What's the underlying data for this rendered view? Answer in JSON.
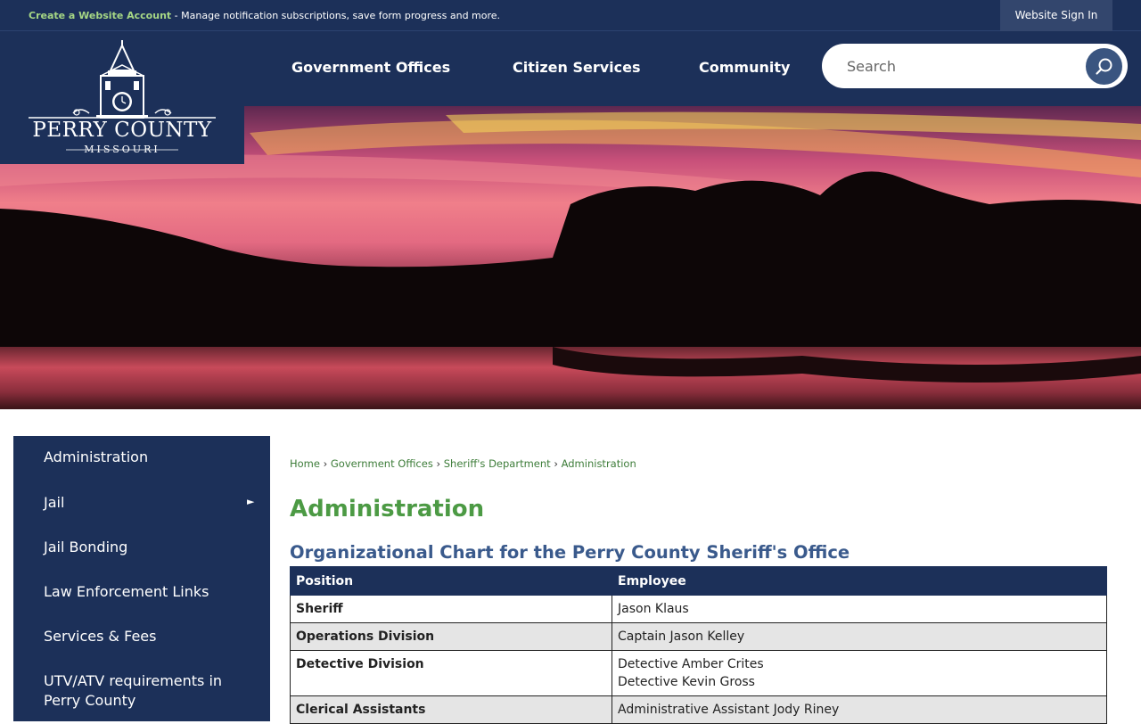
{
  "topbar": {
    "create_account": "Create a Website Account",
    "account_text": " - Manage notification subscriptions, save form progress and more.",
    "sign_in": "Website Sign In"
  },
  "logo": {
    "name": "PERRY COUNTY",
    "sub": "MISSOURI"
  },
  "nav": [
    "Government Offices",
    "Citizen Services",
    "Community"
  ],
  "search": {
    "placeholder": "Search"
  },
  "sidebar": {
    "items": [
      "Administration",
      "Jail",
      "Jail Bonding",
      "Law Enforcement Links",
      "Services & Fees",
      "UTV/ATV requirements in Perry County"
    ]
  },
  "breadcrumb": [
    "Home",
    "Government Offices",
    "Sheriff's Department",
    "Administration"
  ],
  "page": {
    "title": "Administration",
    "chart_title": "Organizational Chart for the Perry County Sheriff's Office"
  },
  "table": {
    "headers": [
      "Position",
      "Employee"
    ],
    "rows": [
      {
        "position": "Sheriff",
        "employees": [
          "Jason Klaus"
        ]
      },
      {
        "position": "Operations Division",
        "employees": [
          "Captain Jason Kelley"
        ]
      },
      {
        "position": "Detective Division",
        "employees": [
          "Detective Amber Crites",
          "Detective Kevin Gross"
        ]
      },
      {
        "position": "Clerical Assistants",
        "employees": [
          "Administrative Assistant Jody Riney"
        ]
      }
    ]
  },
  "colors": {
    "navy": "#1c3059",
    "green": "#4c9a44",
    "link_green": "#3e7d3a",
    "blue_title": "#3a5a8c"
  }
}
